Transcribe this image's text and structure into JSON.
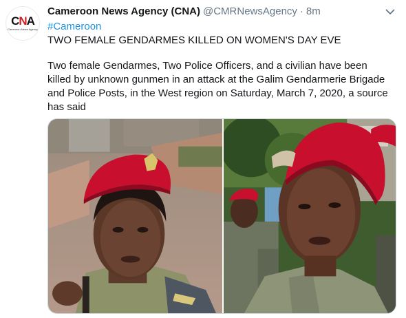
{
  "account": {
    "display_name": "Cameroon News Agency (CNA)",
    "handle": "@CMRNewsAgency",
    "separator": "·",
    "time": "8m",
    "avatar": {
      "logo_text": "CNA",
      "tagline": "Cameroon News Agency",
      "accent_color": "#d21f26"
    }
  },
  "tweet": {
    "hashtag": "#Cameroon",
    "headline": "TWO FEMALE GENDARMES KILLED ON WOMEN'S DAY EVE",
    "body": "Two female Gendarmes, Two Police Officers, and a civilian have been killed by unknown gunmen in an attack at the Galim Gendarmerie Brigade and Police Posts, in the West region on Saturday, March 7, 2020, a source has said"
  },
  "media": {
    "photos": [
      {
        "icon": "photo-gendarme-selfie"
      },
      {
        "icon": "photo-gendarme-portrait"
      }
    ]
  },
  "icons": {
    "menu": "chevron-down-icon"
  },
  "colors": {
    "link": "#1b95e0",
    "secondary_text": "#657786",
    "primary_text": "#14171a",
    "beret_red": "#c8102e"
  }
}
